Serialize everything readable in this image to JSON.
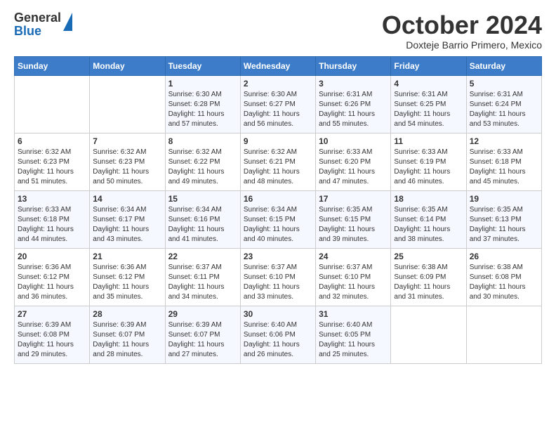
{
  "logo": {
    "general": "General",
    "blue": "Blue"
  },
  "header": {
    "month_title": "October 2024",
    "location": "Doxteje Barrio Primero, Mexico"
  },
  "days_of_week": [
    "Sunday",
    "Monday",
    "Tuesday",
    "Wednesday",
    "Thursday",
    "Friday",
    "Saturday"
  ],
  "weeks": [
    [
      {
        "day": "",
        "sunrise": "",
        "sunset": "",
        "daylight": ""
      },
      {
        "day": "",
        "sunrise": "",
        "sunset": "",
        "daylight": ""
      },
      {
        "day": "1",
        "sunrise": "Sunrise: 6:30 AM",
        "sunset": "Sunset: 6:28 PM",
        "daylight": "Daylight: 11 hours and 57 minutes."
      },
      {
        "day": "2",
        "sunrise": "Sunrise: 6:30 AM",
        "sunset": "Sunset: 6:27 PM",
        "daylight": "Daylight: 11 hours and 56 minutes."
      },
      {
        "day": "3",
        "sunrise": "Sunrise: 6:31 AM",
        "sunset": "Sunset: 6:26 PM",
        "daylight": "Daylight: 11 hours and 55 minutes."
      },
      {
        "day": "4",
        "sunrise": "Sunrise: 6:31 AM",
        "sunset": "Sunset: 6:25 PM",
        "daylight": "Daylight: 11 hours and 54 minutes."
      },
      {
        "day": "5",
        "sunrise": "Sunrise: 6:31 AM",
        "sunset": "Sunset: 6:24 PM",
        "daylight": "Daylight: 11 hours and 53 minutes."
      }
    ],
    [
      {
        "day": "6",
        "sunrise": "Sunrise: 6:32 AM",
        "sunset": "Sunset: 6:23 PM",
        "daylight": "Daylight: 11 hours and 51 minutes."
      },
      {
        "day": "7",
        "sunrise": "Sunrise: 6:32 AM",
        "sunset": "Sunset: 6:23 PM",
        "daylight": "Daylight: 11 hours and 50 minutes."
      },
      {
        "day": "8",
        "sunrise": "Sunrise: 6:32 AM",
        "sunset": "Sunset: 6:22 PM",
        "daylight": "Daylight: 11 hours and 49 minutes."
      },
      {
        "day": "9",
        "sunrise": "Sunrise: 6:32 AM",
        "sunset": "Sunset: 6:21 PM",
        "daylight": "Daylight: 11 hours and 48 minutes."
      },
      {
        "day": "10",
        "sunrise": "Sunrise: 6:33 AM",
        "sunset": "Sunset: 6:20 PM",
        "daylight": "Daylight: 11 hours and 47 minutes."
      },
      {
        "day": "11",
        "sunrise": "Sunrise: 6:33 AM",
        "sunset": "Sunset: 6:19 PM",
        "daylight": "Daylight: 11 hours and 46 minutes."
      },
      {
        "day": "12",
        "sunrise": "Sunrise: 6:33 AM",
        "sunset": "Sunset: 6:18 PM",
        "daylight": "Daylight: 11 hours and 45 minutes."
      }
    ],
    [
      {
        "day": "13",
        "sunrise": "Sunrise: 6:33 AM",
        "sunset": "Sunset: 6:18 PM",
        "daylight": "Daylight: 11 hours and 44 minutes."
      },
      {
        "day": "14",
        "sunrise": "Sunrise: 6:34 AM",
        "sunset": "Sunset: 6:17 PM",
        "daylight": "Daylight: 11 hours and 43 minutes."
      },
      {
        "day": "15",
        "sunrise": "Sunrise: 6:34 AM",
        "sunset": "Sunset: 6:16 PM",
        "daylight": "Daylight: 11 hours and 41 minutes."
      },
      {
        "day": "16",
        "sunrise": "Sunrise: 6:34 AM",
        "sunset": "Sunset: 6:15 PM",
        "daylight": "Daylight: 11 hours and 40 minutes."
      },
      {
        "day": "17",
        "sunrise": "Sunrise: 6:35 AM",
        "sunset": "Sunset: 6:15 PM",
        "daylight": "Daylight: 11 hours and 39 minutes."
      },
      {
        "day": "18",
        "sunrise": "Sunrise: 6:35 AM",
        "sunset": "Sunset: 6:14 PM",
        "daylight": "Daylight: 11 hours and 38 minutes."
      },
      {
        "day": "19",
        "sunrise": "Sunrise: 6:35 AM",
        "sunset": "Sunset: 6:13 PM",
        "daylight": "Daylight: 11 hours and 37 minutes."
      }
    ],
    [
      {
        "day": "20",
        "sunrise": "Sunrise: 6:36 AM",
        "sunset": "Sunset: 6:12 PM",
        "daylight": "Daylight: 11 hours and 36 minutes."
      },
      {
        "day": "21",
        "sunrise": "Sunrise: 6:36 AM",
        "sunset": "Sunset: 6:12 PM",
        "daylight": "Daylight: 11 hours and 35 minutes."
      },
      {
        "day": "22",
        "sunrise": "Sunrise: 6:37 AM",
        "sunset": "Sunset: 6:11 PM",
        "daylight": "Daylight: 11 hours and 34 minutes."
      },
      {
        "day": "23",
        "sunrise": "Sunrise: 6:37 AM",
        "sunset": "Sunset: 6:10 PM",
        "daylight": "Daylight: 11 hours and 33 minutes."
      },
      {
        "day": "24",
        "sunrise": "Sunrise: 6:37 AM",
        "sunset": "Sunset: 6:10 PM",
        "daylight": "Daylight: 11 hours and 32 minutes."
      },
      {
        "day": "25",
        "sunrise": "Sunrise: 6:38 AM",
        "sunset": "Sunset: 6:09 PM",
        "daylight": "Daylight: 11 hours and 31 minutes."
      },
      {
        "day": "26",
        "sunrise": "Sunrise: 6:38 AM",
        "sunset": "Sunset: 6:08 PM",
        "daylight": "Daylight: 11 hours and 30 minutes."
      }
    ],
    [
      {
        "day": "27",
        "sunrise": "Sunrise: 6:39 AM",
        "sunset": "Sunset: 6:08 PM",
        "daylight": "Daylight: 11 hours and 29 minutes."
      },
      {
        "day": "28",
        "sunrise": "Sunrise: 6:39 AM",
        "sunset": "Sunset: 6:07 PM",
        "daylight": "Daylight: 11 hours and 28 minutes."
      },
      {
        "day": "29",
        "sunrise": "Sunrise: 6:39 AM",
        "sunset": "Sunset: 6:07 PM",
        "daylight": "Daylight: 11 hours and 27 minutes."
      },
      {
        "day": "30",
        "sunrise": "Sunrise: 6:40 AM",
        "sunset": "Sunset: 6:06 PM",
        "daylight": "Daylight: 11 hours and 26 minutes."
      },
      {
        "day": "31",
        "sunrise": "Sunrise: 6:40 AM",
        "sunset": "Sunset: 6:05 PM",
        "daylight": "Daylight: 11 hours and 25 minutes."
      },
      {
        "day": "",
        "sunrise": "",
        "sunset": "",
        "daylight": ""
      },
      {
        "day": "",
        "sunrise": "",
        "sunset": "",
        "daylight": ""
      }
    ]
  ]
}
